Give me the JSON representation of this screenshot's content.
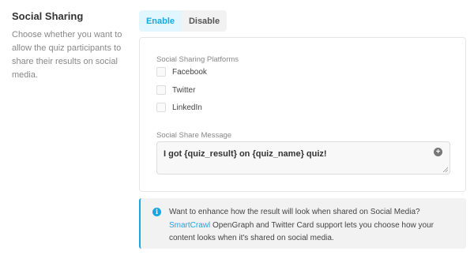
{
  "section": {
    "title": "Social Sharing",
    "description": "Choose whether you want to allow the quiz participants to share their results on social media."
  },
  "toggle": {
    "enable_label": "Enable",
    "disable_label": "Disable",
    "selected": "Enable"
  },
  "platforms": {
    "label": "Social Sharing Platforms",
    "items": [
      {
        "label": "Facebook",
        "checked": false
      },
      {
        "label": "Twitter",
        "checked": false
      },
      {
        "label": "LinkedIn",
        "checked": false
      }
    ]
  },
  "message": {
    "label": "Social Share Message",
    "value": "I got {quiz_result} on {quiz_name} quiz!"
  },
  "notice": {
    "text_before": "Want to enhance how the result will look when shared on Social Media? ",
    "link_text": "SmartCrawl",
    "text_after": " OpenGraph and Twitter Card support lets you choose how your content looks when it's shared on social media."
  },
  "colors": {
    "accent": "#17a8e3",
    "active_bg": "#e1f6ff",
    "notice_bg": "#f2f2f2"
  },
  "icons": [
    "add-variable-icon",
    "info-icon",
    "resize-handle-icon"
  ]
}
